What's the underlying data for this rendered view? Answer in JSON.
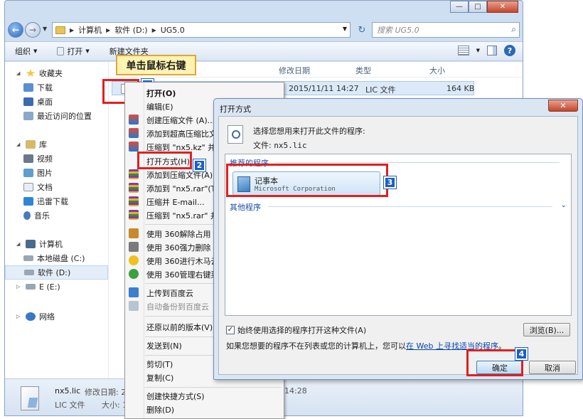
{
  "explorer": {
    "breadcrumbs": [
      "计算机",
      "软件 (D:)",
      "UG5.0"
    ],
    "search_placeholder": "搜索 UG5.0",
    "toolbar": {
      "organize": "组织",
      "open": "打开",
      "new_folder": "新建文件夹"
    },
    "sidebar": {
      "favorites": "收藏夹",
      "downloads": "下载",
      "desktop": "桌面",
      "recent": "最近访问的位置",
      "libraries": "库",
      "videos": "视频",
      "pictures": "图片",
      "documents": "文档",
      "xunlei": "迅雷下载",
      "music": "音乐",
      "computer": "计算机",
      "drive_c": "本地磁盘 (C:)",
      "drive_d": "软件 (D:)",
      "drive_e": "E (E:)",
      "network": "网络"
    },
    "columns": {
      "modified": "修改日期",
      "type": "类型",
      "size": "大小"
    },
    "file": {
      "modified": "2015/11/11 14:27",
      "type": "LIC 文件",
      "size": "164 KB"
    },
    "details": {
      "name": "nx5.lic",
      "modified_label": "修改日期: 2",
      "type": "LIC 文件",
      "size_label": "大小: 1",
      "time_fragment": "14:28"
    }
  },
  "callout": {
    "text": "单击鼠标右键"
  },
  "badges": [
    "1",
    "2",
    "3",
    "4"
  ],
  "context_menu": {
    "items": [
      "打开(O)",
      "编辑(E)",
      "创建压缩文件 (A)...",
      "添加到超高压缩比文",
      "压缩到 \"nx5.kz\" 并",
      "打开方式(H)...",
      "添加到压缩文件(A)...",
      "添加到 \"nx5.rar\"(T)",
      "压缩并 E-mail...",
      "压缩到 \"nx5.rar\" 并",
      "使用 360解除占用",
      "使用 360强力删除",
      "使用 360进行木马云",
      "使用 360管理右键菜",
      "上传到百度云",
      "自动备份到百度云",
      "还原以前的版本(V)",
      "发送到(N)",
      "剪切(T)",
      "复制(C)",
      "创建快捷方式(S)",
      "删除(D)"
    ]
  },
  "dialog": {
    "title": "打开方式",
    "prompt": "选择您想用来打开此文件的程序:",
    "file_label": "文件:",
    "file_name": "nx5.lic",
    "recommended": "推荐的程序",
    "program_name": "记事本",
    "program_publisher": "Microsoft Corporation",
    "other": "其他程序",
    "always_use": "始终使用选择的程序打开这种文件(A)",
    "browse": "浏览(B)...",
    "hint_prefix": "如果您想要的程序不在列表或您的计算机上，您可以",
    "hint_link": "在 Web 上寻找适当的程序",
    "hint_suffix": "。",
    "ok": "确定",
    "cancel": "取消"
  }
}
